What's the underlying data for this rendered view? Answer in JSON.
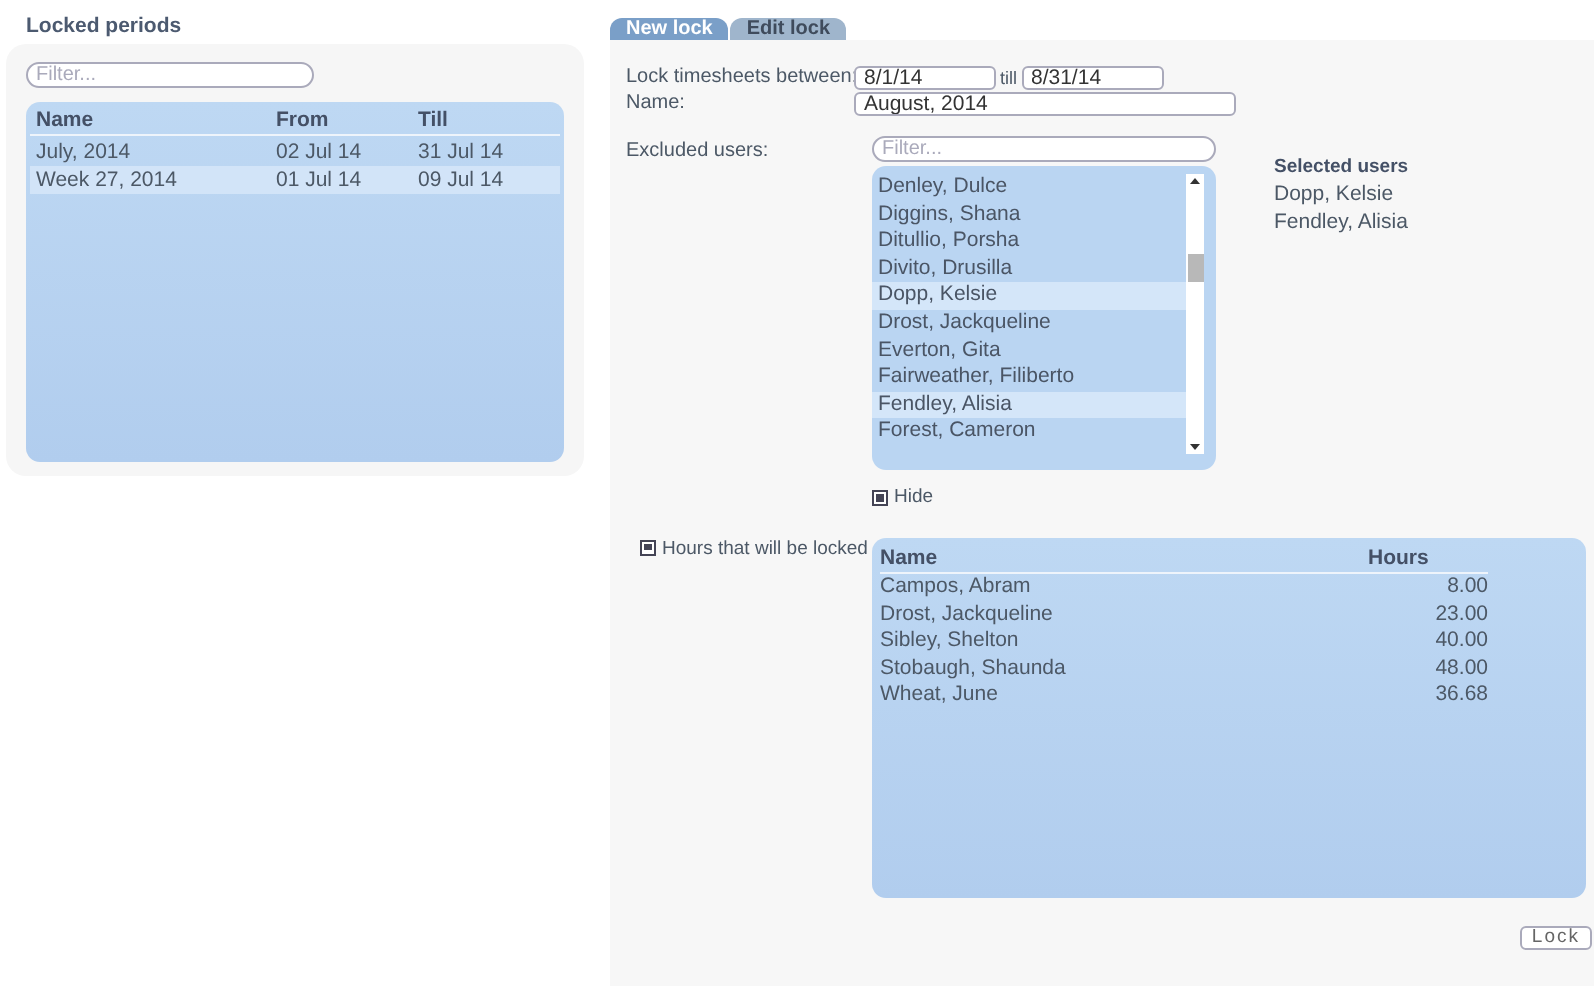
{
  "locked_periods": {
    "title": "Locked periods",
    "filter": {
      "placeholder": "Filter..."
    },
    "columns": [
      "Name",
      "From",
      "Till"
    ],
    "rows": [
      {
        "cells": [
          "July, 2014",
          "02 Jul 14",
          "31 Jul 14"
        ],
        "selected": false
      },
      {
        "cells": [
          "Week 27, 2014",
          "01 Jul 14",
          "09 Jul 14"
        ],
        "selected": true
      }
    ]
  },
  "tabs": [
    {
      "label": "New lock",
      "selected": true
    },
    {
      "label": "Edit lock",
      "selected": false
    }
  ],
  "form": {
    "between_label": "Lock timesheets between:",
    "from": "8/1/14",
    "till_label": "till",
    "till": "8/31/14",
    "name_label": "Name:",
    "name": "August, 2014",
    "excluded_label": "Excluded users:",
    "filter": {
      "placeholder": "Filter..."
    },
    "users": [
      {
        "name": "Denley, Dulce",
        "selected": false
      },
      {
        "name": "Diggins, Shana",
        "selected": false
      },
      {
        "name": "Ditullio, Porsha",
        "selected": false
      },
      {
        "name": "Divito, Drusilla",
        "selected": false
      },
      {
        "name": "Dopp, Kelsie",
        "selected": true
      },
      {
        "name": "Drost, Jackqueline",
        "selected": false
      },
      {
        "name": "Everton, Gita",
        "selected": false
      },
      {
        "name": "Fairweather, Filiberto",
        "selected": false
      },
      {
        "name": "Fendley, Alisia",
        "selected": true
      },
      {
        "name": "Forest, Cameron",
        "selected": false
      }
    ],
    "selected_title": "Selected users",
    "selected_users": [
      "Dopp, Kelsie",
      "Fendley, Alisia"
    ],
    "hide_label": "Hide",
    "hours_label": "Hours that will be locked",
    "hours": {
      "columns": [
        "Name",
        "Hours"
      ],
      "rows": [
        [
          "Campos, Abram",
          "8.00"
        ],
        [
          "Drost, Jackqueline",
          "23.00"
        ],
        [
          "Sibley, Shelton",
          "40.00"
        ],
        [
          "Stobaugh, Shaunda",
          "48.00"
        ],
        [
          "Wheat, June",
          "36.68"
        ]
      ]
    },
    "lock_button": "Lock"
  }
}
